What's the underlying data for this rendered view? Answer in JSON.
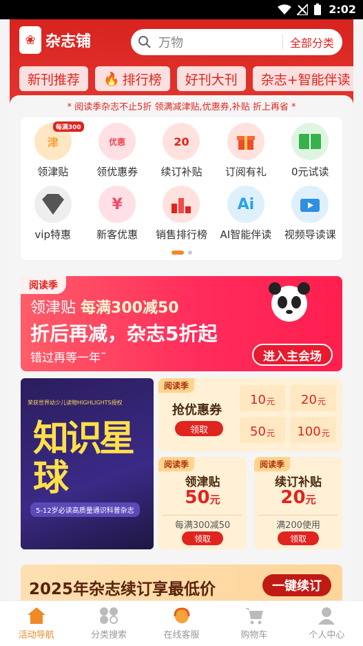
{
  "status": {
    "time": "2:02"
  },
  "header": {
    "logo_text": "杂志铺",
    "search": {
      "placeholder": "万物",
      "category": "全部分类"
    },
    "tabs": [
      "新刊推荐",
      "排行榜",
      "好刊大刊",
      "杂志+智能伴读"
    ]
  },
  "promo_line": "* 阅读季杂志不止5折 领满减津贴,优惠券,补贴 折上再省 *",
  "grid": {
    "badge": "每满300",
    "items": [
      {
        "label": "领津贴",
        "icon": "津",
        "color": "#f9a23a"
      },
      {
        "label": "领优惠券",
        "icon": "优惠",
        "color": "#f04b5a"
      },
      {
        "label": "续订补贴",
        "icon": "20",
        "color": "#e0241f"
      },
      {
        "label": "订阅有礼",
        "icon": "gift",
        "color": "#f04b2a"
      },
      {
        "label": "0元试读",
        "icon": "book",
        "color": "#36b24a"
      },
      {
        "label": "vip特惠",
        "icon": "VIP",
        "color": "#555555"
      },
      {
        "label": "新客优惠",
        "icon": "¥",
        "color": "#f04b6a"
      },
      {
        "label": "销售排行榜",
        "icon": "rank",
        "color": "#e0241f"
      },
      {
        "label": "AI智能伴读",
        "icon": "Ai",
        "color": "#2aa2ea"
      },
      {
        "label": "视频导读课",
        "icon": "tv",
        "color": "#2f8fe0"
      }
    ]
  },
  "banner": {
    "tag": "阅读季",
    "line1_prefix": "领津贴",
    "line1_highlight": "每满300减50",
    "line2": "折后再减，杂志5折起",
    "line3": "错过再等一年˜",
    "button": "进入主会场"
  },
  "poster": {
    "top": "荣获世界幼少儿读物HIGHLIGHTS授权",
    "title": "知识星球",
    "sub": "5-12岁必读高质量通识科普杂志"
  },
  "coupon": {
    "tag": "阅读季",
    "title": "抢优惠券",
    "button": "领取",
    "values": [
      {
        "amount": "10",
        "unit": "元"
      },
      {
        "amount": "20",
        "unit": "元"
      },
      {
        "amount": "50",
        "unit": "元"
      },
      {
        "amount": "100",
        "unit": "元"
      }
    ]
  },
  "subsidy": {
    "tag": "阅读季",
    "title": "领津贴",
    "amount": "50",
    "unit": "元",
    "note": "每满300减50",
    "button": "领取"
  },
  "renew_subsidy": {
    "tag": "阅读季",
    "title": "续订补贴",
    "amount": "20",
    "unit": "元",
    "note": "满200使用",
    "button": "领取"
  },
  "renew_banner": {
    "text": "2025年杂志续订享最低价",
    "button": "一键续订"
  },
  "bottom_nav": [
    {
      "label": "活动导航",
      "active": true
    },
    {
      "label": "分类搜索",
      "active": false
    },
    {
      "label": "在线客服",
      "active": false
    },
    {
      "label": "购物车",
      "active": false
    },
    {
      "label": "个人中心",
      "active": false
    }
  ]
}
